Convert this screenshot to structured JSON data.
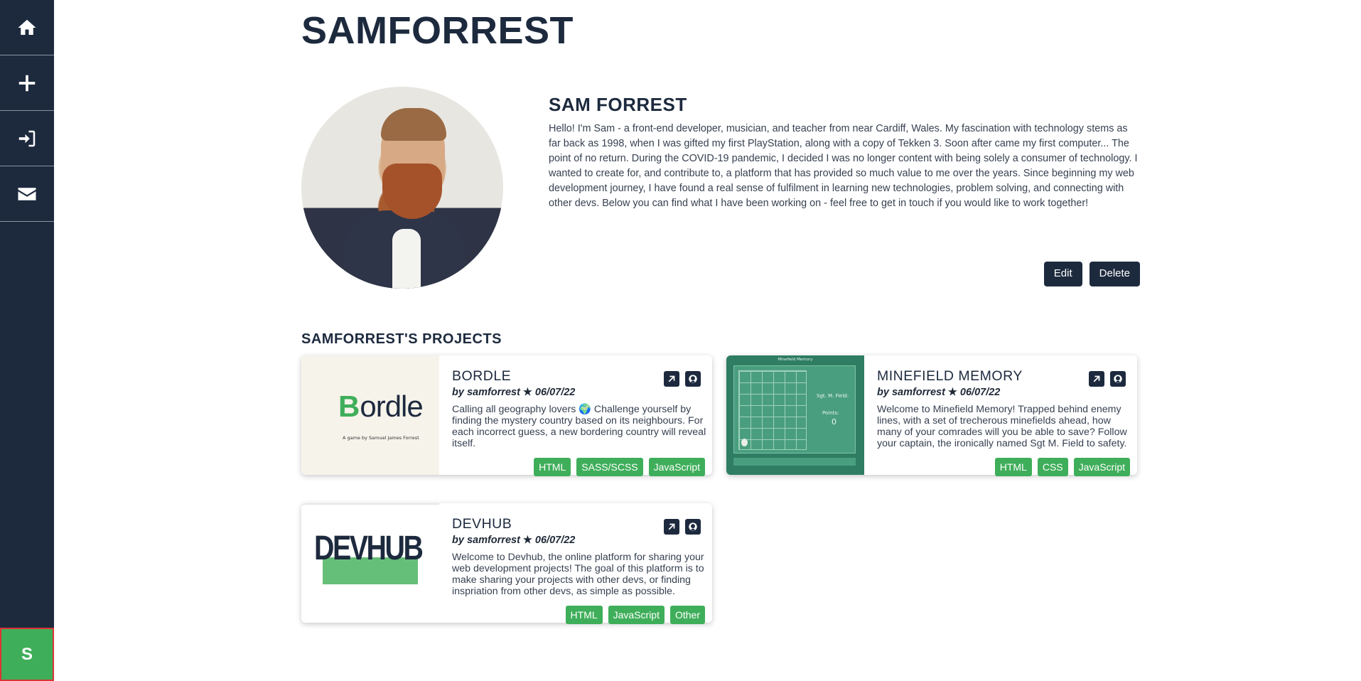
{
  "sidebar": {
    "items": [
      {
        "name": "home",
        "icon": "home-icon"
      },
      {
        "name": "add-project",
        "icon": "plus-icon"
      },
      {
        "name": "login",
        "icon": "sign-in-icon"
      },
      {
        "name": "contact",
        "icon": "envelope-icon"
      }
    ],
    "user_initial": "S"
  },
  "header": {
    "title": "SAMFORREST"
  },
  "profile": {
    "name": "SAM FORREST",
    "bio": "Hello! I'm Sam - a front-end developer, musician, and teacher from near Cardiff, Wales. My fascination with technology stems as far back as 1998, when I was gifted my first PlayStation, along with a copy of Tekken 3. Soon after came my first computer... The point of no return. During the COVID-19 pandemic, I decided I was no longer content with being solely a consumer of technology. I wanted to create for, and contribute to, a platform that has provided so much value to me over the years. Since beginning my web development journey, I have found a real sense of fulfilment in learning new technologies, problem solving, and connecting with other devs. Below you can find what I have been working on - feel free to get in touch if you would like to work together!",
    "edit_label": "Edit",
    "delete_label": "Delete"
  },
  "projects": {
    "section_title": "SAMFORREST'S PROJECTS",
    "items": [
      {
        "title": "BORDLE",
        "author": "by samforrest",
        "date": "06/07/22",
        "description": "Calling all geography lovers 🌍 Challenge yourself by finding the mystery country based on its neighbours. For each incorrect guess, a new bordering country will reveal itself.",
        "thumb_text": "Bordle",
        "thumb_subtext": "A game by Samuel James Forrest",
        "tags": [
          "HTML",
          "SASS/SCSS",
          "JavaScript"
        ]
      },
      {
        "title": "MINEFIELD MEMORY",
        "author": "by samforrest",
        "date": "06/07/22",
        "description": "Welcome to Minefield Memory! Trapped behind enemy lines, with a set of trecherous minefields ahead, how many of your comrades will you be able to save? Follow your captain, the ironically named Sgt M. Field to safety.",
        "thumb_text": "Minefield Memory",
        "thumb_sgt": "Sgt. M. Field:",
        "thumb_points": "Points:",
        "thumb_score": "0",
        "tags": [
          "HTML",
          "CSS",
          "JavaScript"
        ]
      },
      {
        "title": "DEVHUB",
        "author": "by samforrest",
        "date": "06/07/22",
        "description": "Welcome to Devhub, the online platform for sharing your web development projects! The goal of this platform is to make sharing your projects with other devs, or finding inspriation from other devs, as simple as possible.",
        "thumb_text": "DEVHUB",
        "tags": [
          "HTML",
          "JavaScript",
          "Other"
        ]
      }
    ]
  },
  "colors": {
    "sidebar": "#1d2a3e",
    "accent": "#3fae5a",
    "highlight": "#66bf78",
    "minefield": "#2f7d63"
  }
}
